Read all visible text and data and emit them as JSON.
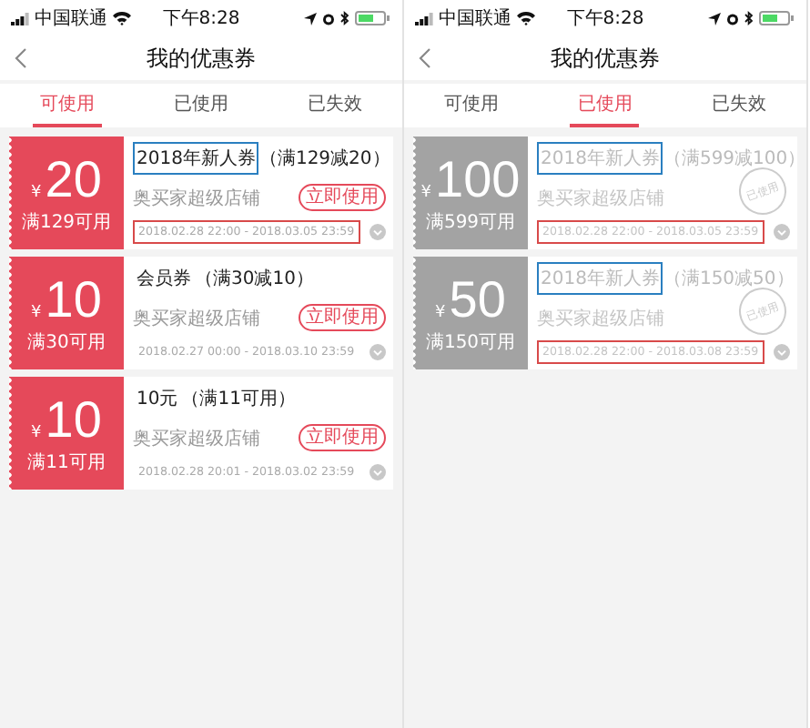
{
  "screens": [
    {
      "status": {
        "carrier": "中国联通",
        "time": "下午8:28"
      },
      "title": "我的优惠券",
      "tabs": [
        {
          "label": "可使用",
          "selected": true
        },
        {
          "label": "已使用",
          "selected": false
        },
        {
          "label": "已失效",
          "selected": false
        }
      ],
      "coupons": [
        {
          "kind": "available",
          "currency": "¥",
          "amount": "20",
          "condition": "满129可用",
          "name": "2018年新人券",
          "detail": "（满129减20）",
          "name_highlighted": true,
          "store": "奥买家超级店铺",
          "action": "立即使用",
          "period": "2018.02.28 22:00 - 2018.03.05 23:59",
          "period_highlighted": true
        },
        {
          "kind": "available",
          "currency": "¥",
          "amount": "10",
          "condition": "满30可用",
          "name": "会员券",
          "detail": "（满30减10）",
          "name_highlighted": false,
          "store": "奥买家超级店铺",
          "action": "立即使用",
          "period": "2018.02.27 00:00 - 2018.03.10 23:59",
          "period_highlighted": false
        },
        {
          "kind": "available",
          "currency": "¥",
          "amount": "10",
          "condition": "满11可用",
          "name": "10元",
          "detail": "（满11可用）",
          "name_highlighted": false,
          "store": "奥买家超级店铺",
          "action": "立即使用",
          "period": "2018.02.28 20:01 - 2018.03.02 23:59",
          "period_highlighted": false
        }
      ]
    },
    {
      "status": {
        "carrier": "中国联通",
        "time": "下午8:28"
      },
      "title": "我的优惠券",
      "tabs": [
        {
          "label": "可使用",
          "selected": false
        },
        {
          "label": "已使用",
          "selected": true
        },
        {
          "label": "已失效",
          "selected": false
        }
      ],
      "coupons": [
        {
          "kind": "used",
          "currency": "¥",
          "amount": "100",
          "condition": "满599可用",
          "name": "2018年新人券",
          "detail": "（满599减100）",
          "name_highlighted": true,
          "store": "奥买家超级店铺",
          "stamp": "已使用",
          "period": "2018.02.28 22:00 - 2018.03.05 23:59",
          "period_highlighted": true
        },
        {
          "kind": "used",
          "currency": "¥",
          "amount": "50",
          "condition": "满150可用",
          "name": "2018年新人券",
          "detail": "（满150减50）",
          "name_highlighted": true,
          "store": "奥买家超级店铺",
          "stamp": "已使用",
          "period": "2018.02.28 22:00 - 2018.03.08 23:59",
          "period_highlighted": true
        }
      ]
    }
  ]
}
